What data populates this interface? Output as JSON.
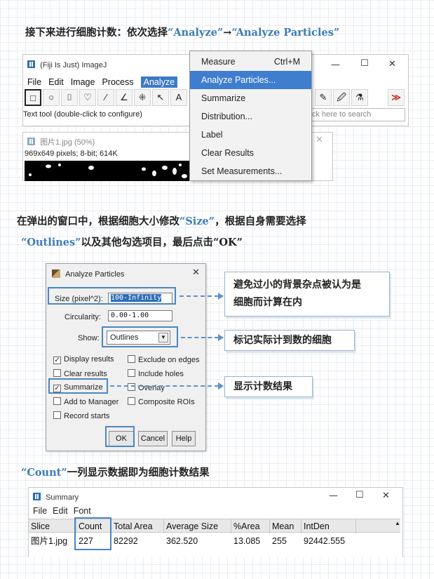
{
  "step1": {
    "heading_prefix": "接下来进行细胞计数：依次选择",
    "analyze": "“Analyze”",
    "arrow": "→",
    "analyze_particles": "“Analyze Particles”"
  },
  "imagej": {
    "title": "(Fiji Is Just) ImageJ",
    "menus": [
      "File",
      "Edit",
      "Image",
      "Process",
      "Analyze"
    ],
    "status_text": "Text tool (double-click to configure)",
    "search_placeholder": "lick here to search",
    "min_glyph": "—",
    "max_glyph": "☐",
    "close_glyph": "✕",
    "more_tools": "≫",
    "tools": [
      "□",
      "○",
      "⌷",
      "♡",
      "∕",
      "∠",
      "⁜",
      "↖",
      "A"
    ],
    "right_tools": [
      "✎",
      "🖉",
      "⚗"
    ]
  },
  "analyze_menu": {
    "items": [
      {
        "label": "Measure",
        "shortcut": "Ctrl+M"
      },
      {
        "label": "Analyze Particles...",
        "shortcut": ""
      },
      {
        "label": "Summarize",
        "shortcut": ""
      },
      {
        "label": "Distribution...",
        "shortcut": ""
      },
      {
        "label": "Label",
        "shortcut": ""
      },
      {
        "label": "Clear Results",
        "shortcut": ""
      },
      {
        "label": "Set Measurements...",
        "shortcut": ""
      }
    ],
    "selected_index": 1
  },
  "image_window": {
    "title": "图片1.jpg (50%)",
    "info": "969x649 pixels; 8-bit; 614K",
    "close_glyph": "✕"
  },
  "step2": {
    "line1_prefix": "在弹出的窗口中，根据细胞大小修改",
    "size": "“Size”",
    "line1_suffix": "，根据自身需要选择",
    "outlines": "“Outlines”",
    "line2_suffix": "以及其他勾选项目，最后点击“OK”"
  },
  "dialog": {
    "title": "Analyze Particles",
    "close_glyph": "✕",
    "size_label": "Size (pixel^2):",
    "size_value": "100-Infinity",
    "circularity_label": "Circularity:",
    "circularity_value": "0.00-1.00",
    "show_label": "Show:",
    "show_value": "Outlines",
    "checkboxes_left": [
      {
        "label": "Display results",
        "checked": true
      },
      {
        "label": "Clear results",
        "checked": false
      },
      {
        "label": "Summarize",
        "checked": true
      },
      {
        "label": "Add to Manager",
        "checked": false
      },
      {
        "label": "Record starts",
        "checked": false
      }
    ],
    "checkboxes_right": [
      {
        "label": "Exclude on edges",
        "checked": false
      },
      {
        "label": "Include holes",
        "checked": false
      },
      {
        "label": "Overlay",
        "checked": false
      },
      {
        "label": "Composite ROIs",
        "checked": false
      }
    ],
    "ok": "OK",
    "cancel": "Cancel",
    "help": "Help"
  },
  "notes": {
    "size_note_1": "避免过小的背景杂点被认为是",
    "size_note_2": "细胞而计算在内",
    "outlines_note": "标记实际计到数的细胞",
    "summarize_note": "显示计数结果"
  },
  "step3": {
    "count": "“Count”",
    "suffix": "一列显示数据即为细胞计数结果"
  },
  "summary": {
    "title": "Summary",
    "menus": [
      "File",
      "Edit",
      "Font"
    ],
    "columns": [
      "Slice",
      "Count",
      "Total Area",
      "Average Size",
      "%Area",
      "Mean",
      "IntDen"
    ],
    "row": [
      "图片1.jpg",
      "227",
      "82292",
      "362.520",
      "13.085",
      "255",
      "92442.555"
    ],
    "min_glyph": "—",
    "max_glyph": "☐",
    "close_glyph": "✕"
  },
  "colors": {
    "accent": "#3d7cb8",
    "menu_highlight": "#3f7ecf",
    "callout": "#4a87c3"
  }
}
